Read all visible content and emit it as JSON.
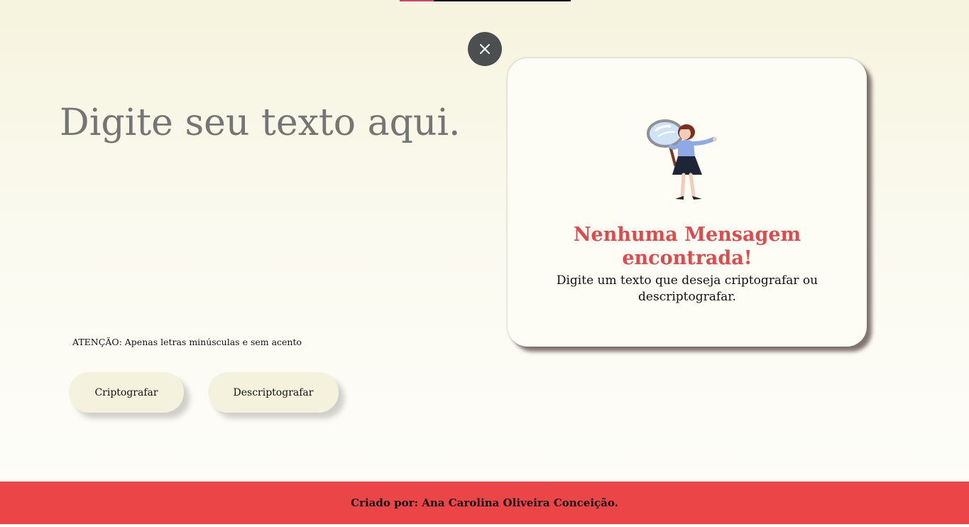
{
  "input": {
    "placeholder": "Digite seu texto aqui.",
    "value": ""
  },
  "warning": "ATENÇÃO: Apenas letras minúsculas e sem acento",
  "buttons": {
    "encrypt_label": "Criptografar",
    "decrypt_label": "Descriptografar"
  },
  "output_card": {
    "title": "Nenhuma Mensagem encontrada!",
    "message": "Digite um texto que deseja criptografar ou descriptografar."
  },
  "footer": {
    "text": "Criado por: Ana Carolina Oliveira Conceição."
  },
  "icons": {
    "close": "close-icon",
    "illustration": "woman-with-magnifying-glass"
  },
  "colors": {
    "accent_red": "#ec4548",
    "title_red": "#e04a4b",
    "button_bg": "#f4f2dc",
    "close_bg": "#4b4f50"
  }
}
